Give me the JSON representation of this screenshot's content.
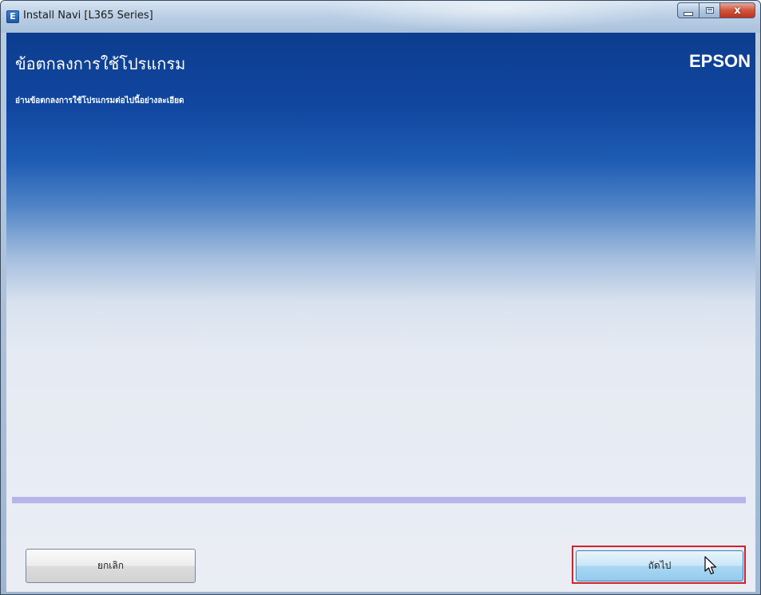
{
  "window": {
    "title": "Install Navi [L365 Series]",
    "app_icon_letter": "E",
    "close_glyph": "x"
  },
  "page": {
    "heading": "ข้อตกลงการใช้โปรแกรม",
    "subheading": "อ่านข้อตกลงการใช้โปรแกรมต่อไปนี้อย่างละเอียด",
    "brand": "EPSON"
  },
  "footer": {
    "cancel_label": "ยกเลิก",
    "next_label": "ถัดไป"
  },
  "colors": {
    "header_blue": "#0c3d8f",
    "highlight_red": "#d2222a",
    "progress_band": "#b7b4ea",
    "next_button": "#a9d7f3"
  }
}
